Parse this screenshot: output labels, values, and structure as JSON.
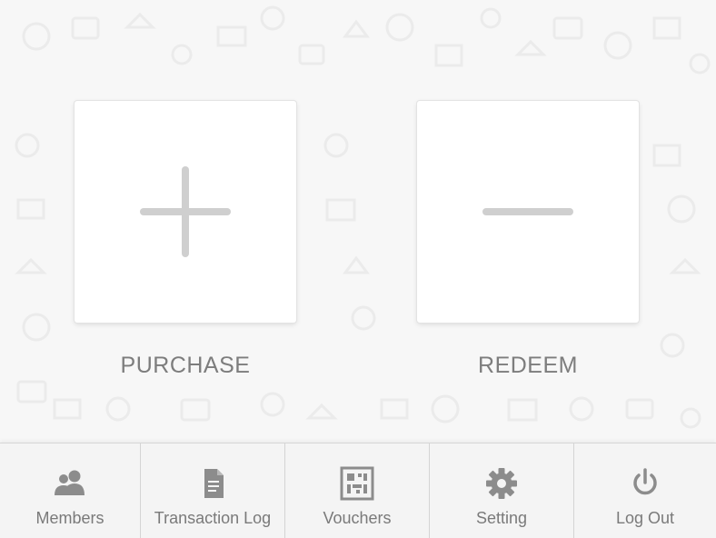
{
  "actions": {
    "purchase_label": "PURCHASE",
    "redeem_label": "REDEEM"
  },
  "nav": {
    "items": [
      {
        "label": "Members",
        "icon": "members-icon"
      },
      {
        "label": "Transaction Log",
        "icon": "document-icon"
      },
      {
        "label": "Vouchers",
        "icon": "qr-code-icon"
      },
      {
        "label": "Setting",
        "icon": "gear-icon"
      },
      {
        "label": "Log Out",
        "icon": "power-icon"
      }
    ]
  },
  "colors": {
    "background": "#f7f7f7",
    "icon": "#8c8c8c",
    "symbol": "#cfcfcf",
    "label": "#7d7d7d"
  }
}
